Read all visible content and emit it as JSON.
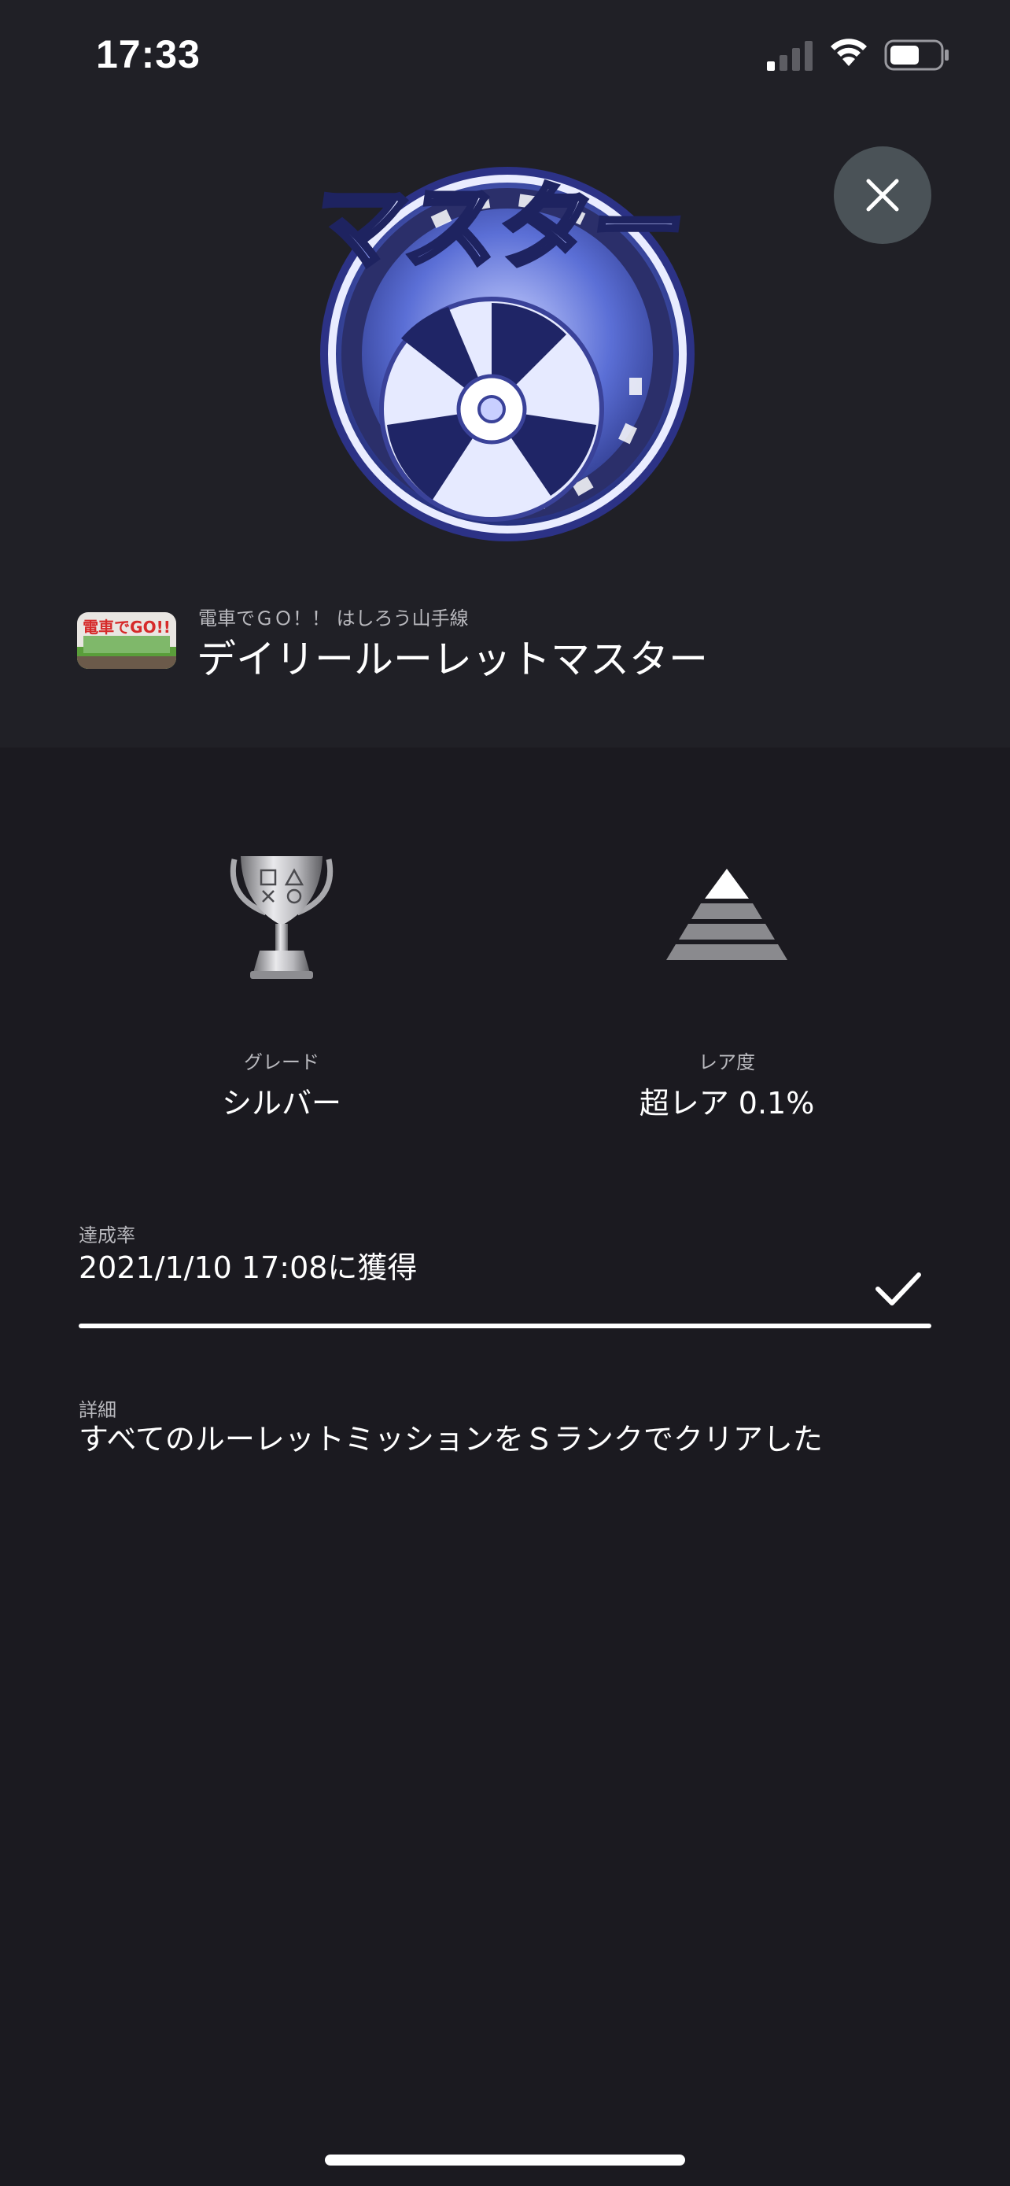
{
  "status_bar": {
    "time": "17:33",
    "signal_icon": "cellular-signal-icon",
    "wifi_icon": "wifi-icon",
    "battery_icon": "battery-icon",
    "battery_level": 0.5
  },
  "header": {
    "close_icon": "close-icon",
    "trophy_art_icon": "master-trophy-emblem",
    "trophy_art_text": "マスター",
    "game_icon": "game-cover-icon",
    "game_icon_text": "電車でGO!!",
    "game_title": "電車でＧＯ！！ はしろう山手線",
    "trophy_name": "デイリールーレットマスター"
  },
  "stats": {
    "grade": {
      "icon": "silver-trophy-icon",
      "label": "グレード",
      "value": "シルバー"
    },
    "rarity": {
      "icon": "rarity-pyramid-icon",
      "label": "レア度",
      "value": "超レア 0.1%"
    }
  },
  "progress": {
    "label": "達成率",
    "value": "2021/1/10  17:08に獲得",
    "percent": 100,
    "check_icon": "checkmark-icon"
  },
  "details": {
    "label": "詳細",
    "text": "すべてのルーレットミッションをＳランクでクリアした"
  },
  "colors": {
    "background": "#1b1a20",
    "header_background": "#202026",
    "close_button": "#4a5257",
    "secondary_text": "#b9b9be",
    "emblem_blue": "#4a5fc4"
  }
}
